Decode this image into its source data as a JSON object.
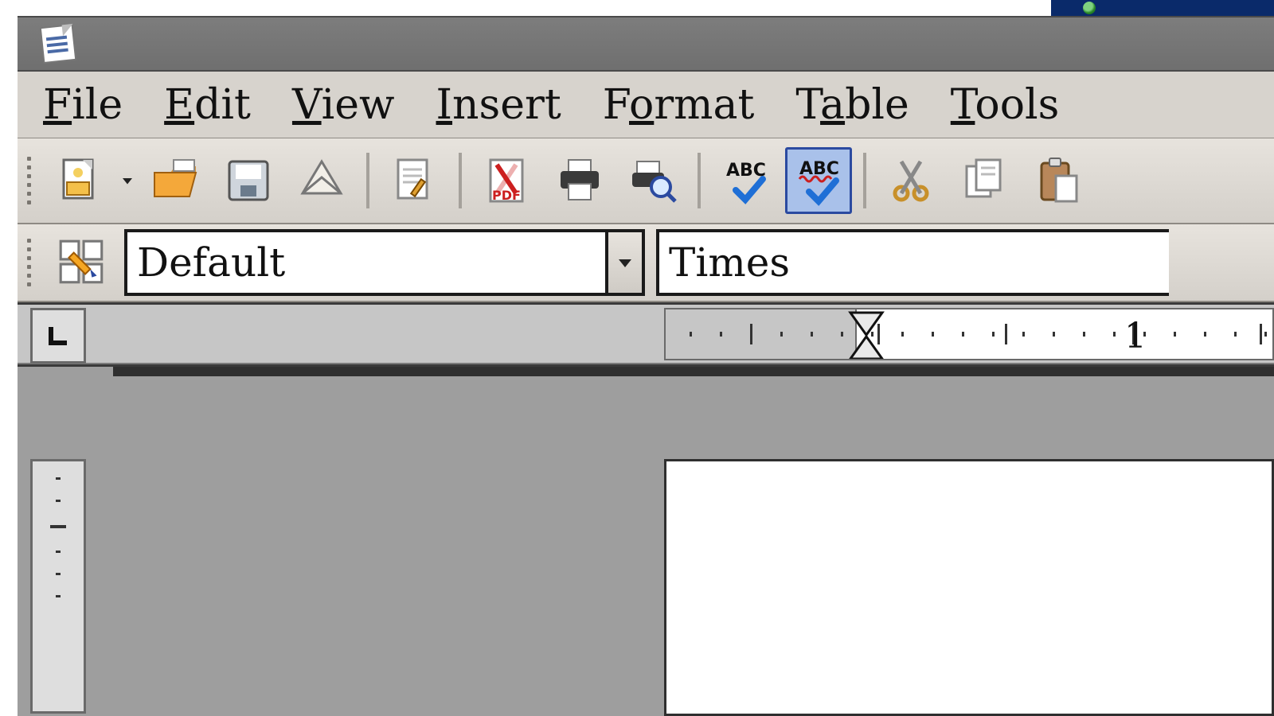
{
  "menu": {
    "file": "File",
    "edit": "Edit",
    "view": "View",
    "insert": "Insert",
    "format": "Format",
    "table": "Table",
    "tools": "Tools"
  },
  "toolbar": {
    "abc1": "ABC",
    "abc2": "ABC",
    "pdf": "PDF"
  },
  "formatbar": {
    "style": "Default",
    "font": "Times"
  },
  "ruler": {
    "mark1": "1",
    "tabstop_glyph": "└"
  }
}
